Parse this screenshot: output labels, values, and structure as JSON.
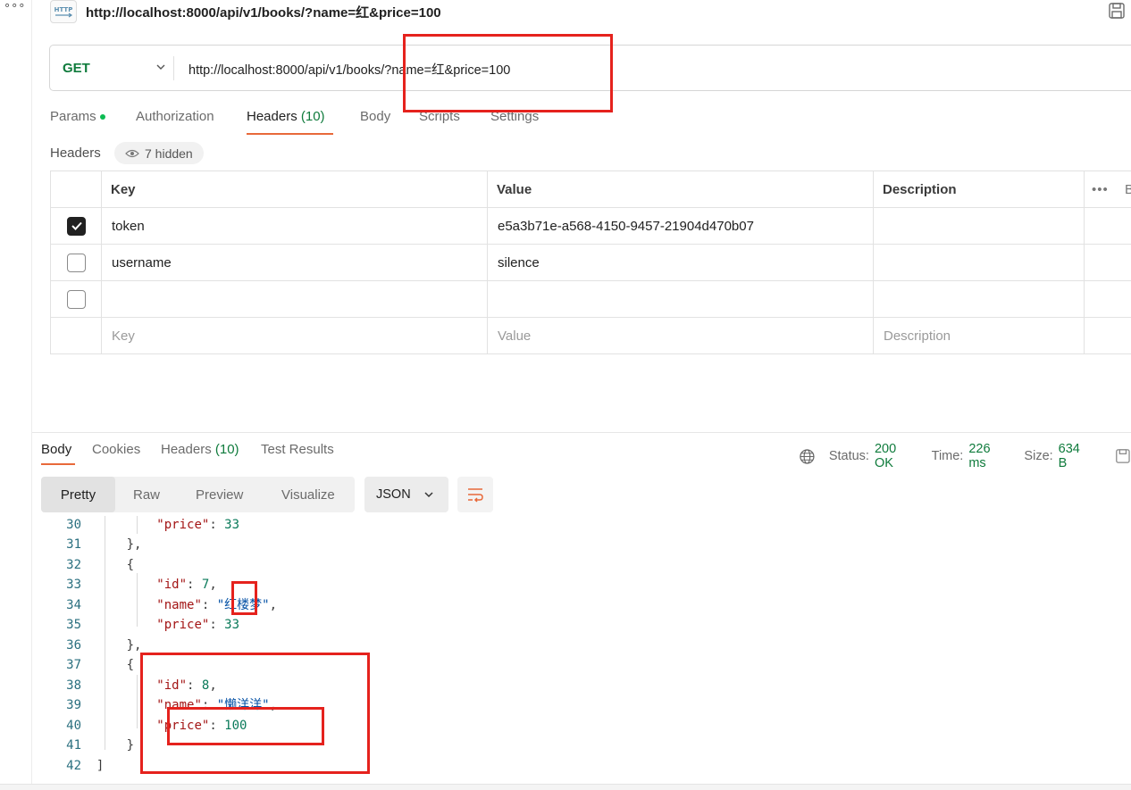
{
  "tab": {
    "title": "http://localhost:8000/api/v1/books/?name=红&price=100",
    "icon": "http-icon"
  },
  "request": {
    "method": "GET",
    "url": "http://localhost:8000/api/v1/books/?name=红&price=100"
  },
  "request_tabs": {
    "params": "Params",
    "authorization": "Authorization",
    "headers": "Headers",
    "headers_count": "(10)",
    "body": "Body",
    "scripts": "Scripts",
    "settings": "Settings"
  },
  "headers_section": {
    "label": "Headers",
    "hidden": "7 hidden"
  },
  "headers_table": {
    "columns": {
      "key": "Key",
      "value": "Value",
      "description": "Description",
      "bulk": "B"
    },
    "rows": [
      {
        "checked": true,
        "key": "token",
        "value": "e5a3b71e-a568-4150-9457-21904d470b07",
        "description": ""
      },
      {
        "checked": false,
        "key": "username",
        "value": "silence",
        "description": ""
      },
      {
        "checked": false,
        "key": "",
        "value": "",
        "description": ""
      }
    ],
    "placeholders": {
      "key": "Key",
      "value": "Value",
      "description": "Description"
    }
  },
  "response_tabs": {
    "body": "Body",
    "cookies": "Cookies",
    "headers": "Headers",
    "headers_count": "(10)",
    "test_results": "Test Results"
  },
  "response_status": {
    "status_label": "Status:",
    "status_value": "200 OK",
    "time_label": "Time:",
    "time_value": "226 ms",
    "size_label": "Size:",
    "size_value": "634 B"
  },
  "format_buttons": {
    "pretty": "Pretty",
    "raw": "Raw",
    "preview": "Preview",
    "visualize": "Visualize"
  },
  "language_select": "JSON",
  "code_lines": [
    {
      "n": "30",
      "t": "price-33-a"
    },
    {
      "n": "31"
    },
    {
      "n": "32"
    },
    {
      "n": "33"
    },
    {
      "n": "34"
    },
    {
      "n": "35"
    },
    {
      "n": "36"
    },
    {
      "n": "37"
    },
    {
      "n": "38"
    },
    {
      "n": "39"
    },
    {
      "n": "40"
    },
    {
      "n": "41"
    },
    {
      "n": "42"
    }
  ],
  "code_tokens": {
    "price_key": "\"price\"",
    "id_key": "\"id\"",
    "name_key": "\"name\"",
    "price_33": "33",
    "id_7": "7",
    "id_8": "8",
    "name_hlm": "\"红楼梦\"",
    "name_lyy": "\"懒洋洋\"",
    "price_100": "100"
  },
  "colors": {
    "accent": "#e8693a",
    "method_green": "#0f7b3c",
    "annotation_red": "#e5221d"
  }
}
